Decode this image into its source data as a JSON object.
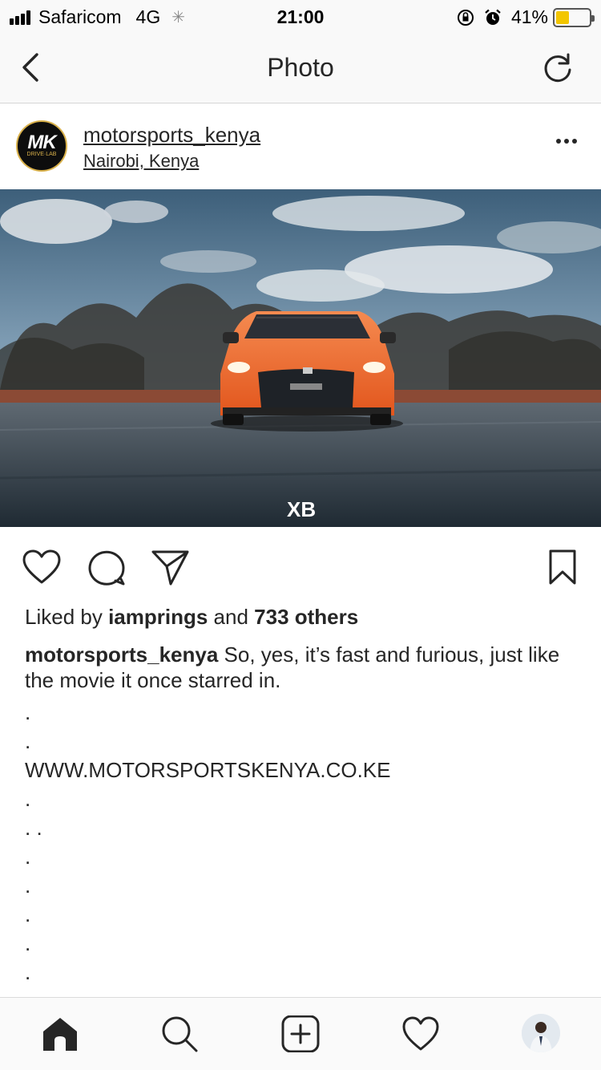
{
  "status_bar": {
    "carrier": "Safaricom",
    "network": "4G",
    "time": "21:00",
    "battery_percent": "41%",
    "battery_level": 0.41,
    "icons": [
      "signal-icon",
      "activity-spinner-icon",
      "orientation-lock-icon",
      "alarm-icon",
      "battery-icon"
    ]
  },
  "nav": {
    "title": "Photo",
    "back_icon": "chevron-left-icon",
    "refresh_icon": "refresh-icon"
  },
  "post": {
    "username": "motorsports_kenya",
    "location": "Nairobi, Kenya",
    "avatar": {
      "text": "MK",
      "subtext": "DRIVE·LAB",
      "accent": "#d8b04a"
    },
    "photo": {
      "watermark": "XB",
      "subject": "orange sports car on road"
    },
    "likes": {
      "prefix": "Liked by ",
      "user": "iamprings",
      "middle": " and ",
      "others": "733 others"
    },
    "caption": {
      "user": "motorsports_kenya",
      "text": "So, yes, it’s fast and furious, just like the movie it once starred in.",
      "lines": [
        ".",
        ".",
        "WWW.MOTORSPORTSKENYA.CO.KE",
        ".",
        ". .",
        ".",
        ".",
        ".",
        ".",
        "."
      ]
    }
  },
  "tabbar": {
    "items": [
      "home-icon",
      "search-icon",
      "new-post-icon",
      "activity-heart-icon",
      "profile-avatar"
    ]
  },
  "colors": {
    "text": "#262626",
    "car_orange": "#f26a2e",
    "battery_yellow": "#f3c600"
  }
}
